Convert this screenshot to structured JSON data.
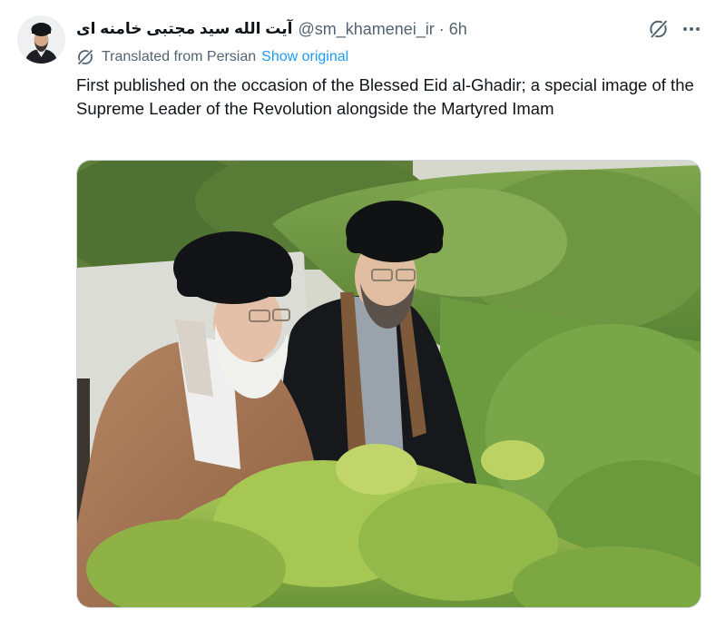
{
  "author": {
    "display_name": "آیت الله سید مجتبی خامنه ای",
    "handle": "@sm_khamenei_ir",
    "separator": "·",
    "time": "6h",
    "avatar_icon": "user-avatar"
  },
  "translation": {
    "label": "Translated from Persian",
    "show_original": "Show original",
    "icon": "translate-icon"
  },
  "tweet": {
    "text": "First published on the occasion of the Blessed Eid al-Ghadir; a special image of the Supreme Leader of the Revolution alongside the Martyred Imam"
  },
  "actions": {
    "grok_icon": "grok-icon",
    "more_icon": "more-icon"
  },
  "colors": {
    "link": "#1d9bf0",
    "secondary_text": "#536471",
    "primary_text": "#0f1419"
  }
}
